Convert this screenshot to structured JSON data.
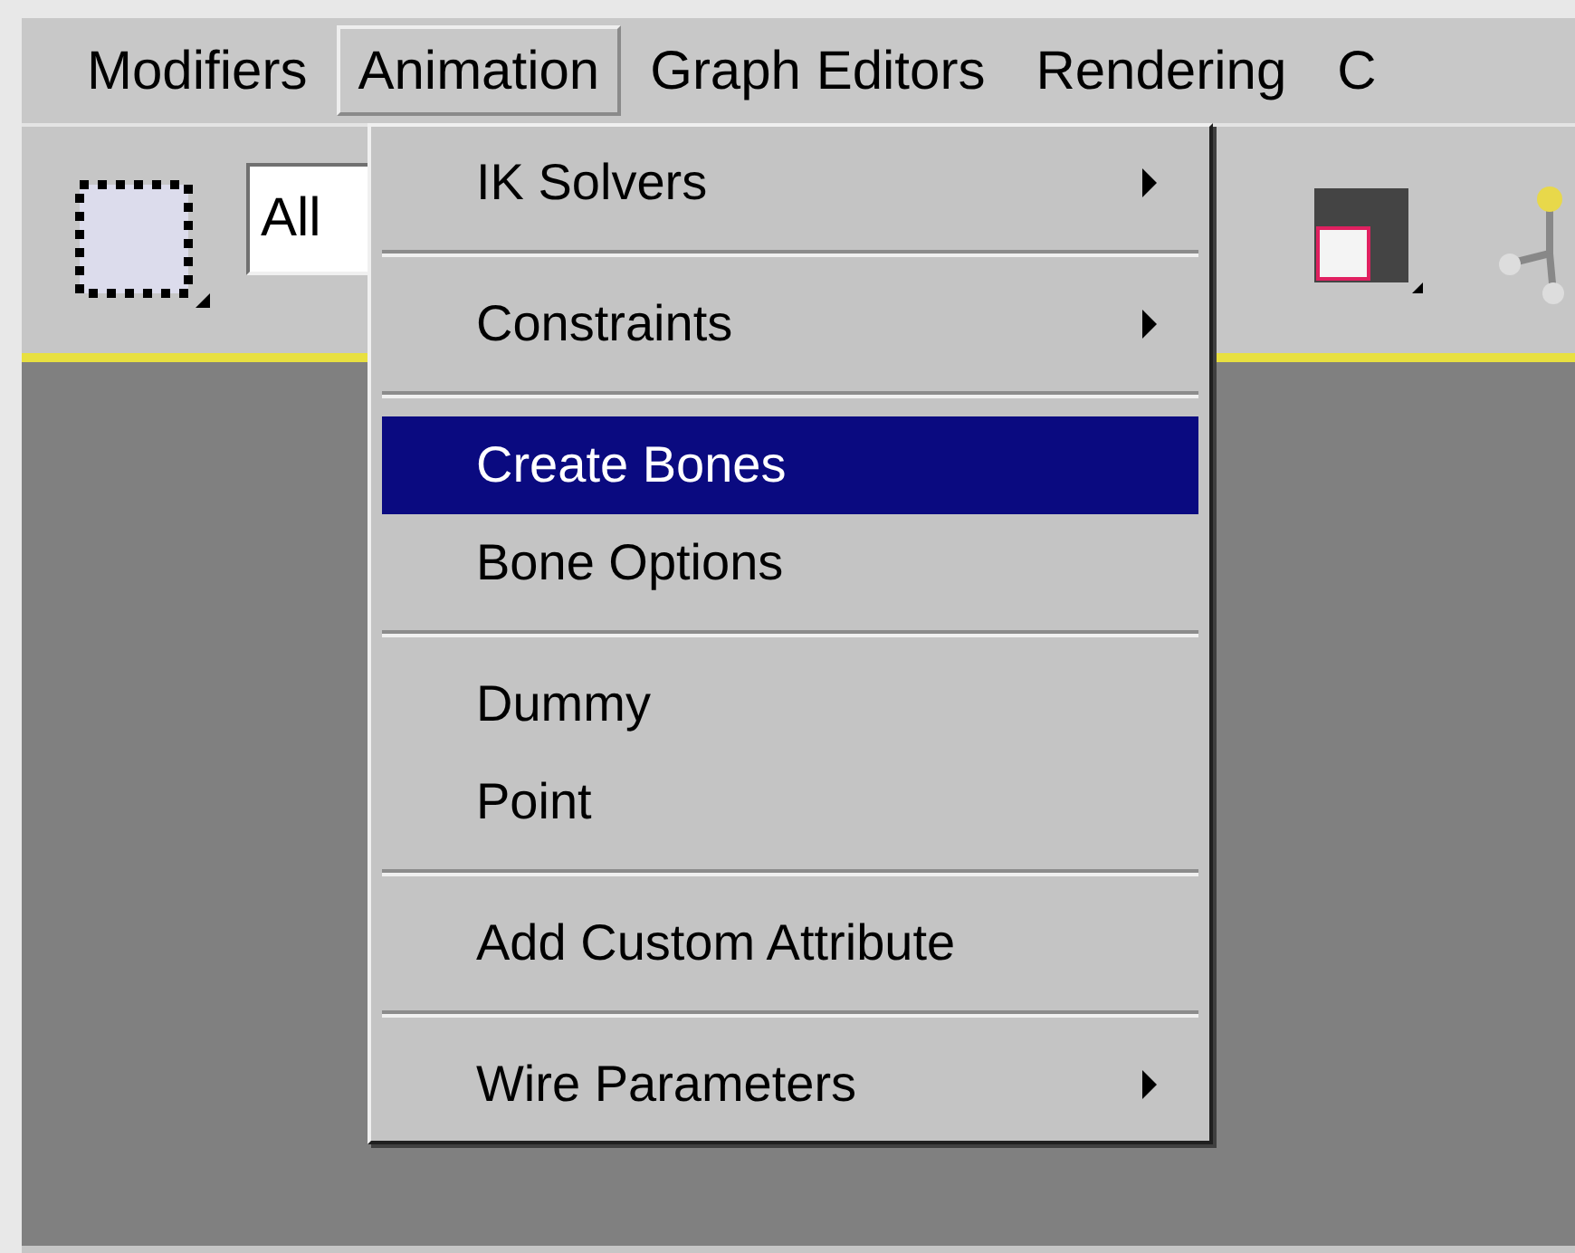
{
  "menu_bar": [
    {
      "label": "Modifiers",
      "selected": false
    },
    {
      "label": "Animation",
      "selected": true
    },
    {
      "label": "Graph Editors",
      "selected": false
    },
    {
      "label": "Rendering",
      "selected": false
    },
    {
      "label": "C",
      "selected": false
    }
  ],
  "toolbar": {
    "filter_value": "All"
  },
  "dropdown_menu": [
    {
      "kind": "item",
      "label": "IK Solvers",
      "submenu": true,
      "selected": false
    },
    {
      "kind": "separator"
    },
    {
      "kind": "item",
      "label": "Constraints",
      "submenu": true,
      "selected": false
    },
    {
      "kind": "separator"
    },
    {
      "kind": "item",
      "label": "Create Bones",
      "submenu": false,
      "selected": true
    },
    {
      "kind": "item",
      "label": "Bone Options",
      "submenu": false,
      "selected": false
    },
    {
      "kind": "separator"
    },
    {
      "kind": "item",
      "label": "Dummy",
      "submenu": false,
      "selected": false
    },
    {
      "kind": "item",
      "label": "Point",
      "submenu": false,
      "selected": false
    },
    {
      "kind": "separator"
    },
    {
      "kind": "item",
      "label": "Add Custom Attribute",
      "submenu": false,
      "selected": false
    },
    {
      "kind": "separator"
    },
    {
      "kind": "item",
      "label": "Wire Parameters",
      "submenu": true,
      "selected": false
    }
  ]
}
